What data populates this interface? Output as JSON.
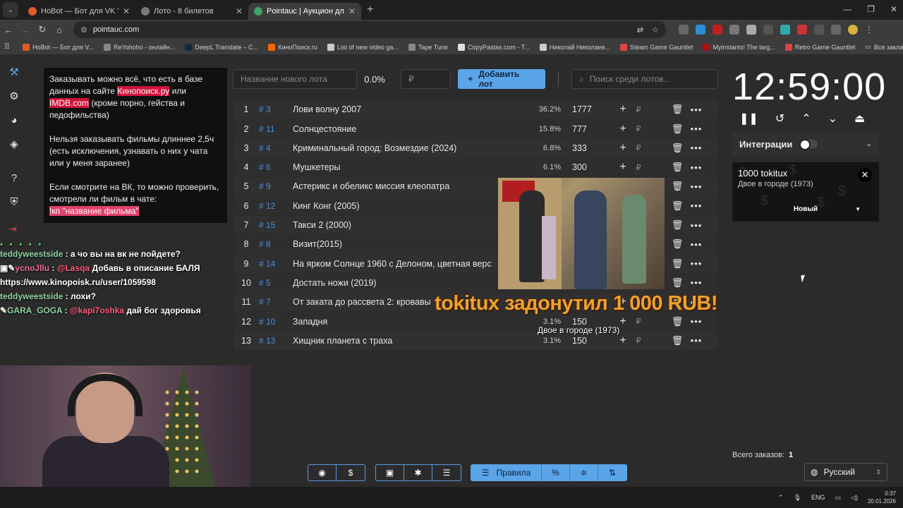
{
  "browser": {
    "tabs": [
      {
        "title": "HoBot — Бот для VK Video Live",
        "active": false,
        "color": "#e05a2a"
      },
      {
        "title": "Лото - 8 билетов",
        "active": false,
        "color": "#7a7a7a"
      },
      {
        "title": "Pointauc | Аукцион для стримов",
        "active": true,
        "color": "#3fa36a"
      }
    ],
    "url": "pointauc.com",
    "bookmarks": [
      {
        "label": "HoBot — Бот для V...",
        "color": "#e05a2a"
      },
      {
        "label": "ReYohoho - онлайн...",
        "color": "#888888"
      },
      {
        "label": "DeepL Translate – C...",
        "color": "#0f2b46"
      },
      {
        "label": "КиноПоиск.ru",
        "color": "#ff6600"
      },
      {
        "label": "List of new video ga...",
        "color": "#cccccc"
      },
      {
        "label": "Tape Tune",
        "color": "#888888"
      },
      {
        "label": "CopyPastas.com - T...",
        "color": "#e0e0e0"
      },
      {
        "label": "Николай Николаев...",
        "color": "#cccccc"
      },
      {
        "label": "Steam Game Gauntlet",
        "color": "#d44"
      },
      {
        "label": "Myinstants! The larg...",
        "color": "#aa1111"
      },
      {
        "label": "Retro Game Gauntlet",
        "color": "#d44"
      }
    ],
    "all_bookmarks": "Все закладки"
  },
  "info": {
    "p1_before": "Заказывать можно всё, что есть в базе данных на сайте ",
    "p1_link1": "Кинопоиск.ру",
    "p1_mid": " или ",
    "p1_link2": "IMDB.com",
    "p1_after": " (кроме порно, гейства и педофильства)",
    "p2": "Нельзя заказывать фильмы длиннее 2,5ч (есть исключения, узнавать о них у чата или у меня заранее)",
    "p3": "Если смотрите на ВК, то можно проверить, смотрели ли фильм в чате:",
    "p3_cmd": "!кп \"название фильма\""
  },
  "toolbar": {
    "new_lot_placeholder": "Название нового лота",
    "percent": "0.0%",
    "amount_placeholder": "₽",
    "add_button": "Добавить лот",
    "search_placeholder": "Поиск среди лотов..."
  },
  "lots": [
    {
      "n": "1",
      "id": "# 3",
      "name": "Лови волну 2007",
      "pct": "36.2%",
      "amount": "1777",
      "cur": "₽"
    },
    {
      "n": "2",
      "id": "# 11",
      "name": "Солнцестояние",
      "pct": "15.8%",
      "amount": "777",
      "cur": "₽"
    },
    {
      "n": "3",
      "id": "# 4",
      "name": "Криминальный город: Возмездие (2024)",
      "pct": "6.8%",
      "amount": "333",
      "cur": "₽"
    },
    {
      "n": "4",
      "id": "# 6",
      "name": "Мушкетеры",
      "pct": "6.1%",
      "amount": "300",
      "cur": "₽"
    },
    {
      "n": "5",
      "id": "# 9",
      "name": "Астерикс и обеликс миссия клеопатра",
      "pct": "",
      "amount": "",
      "cur": ""
    },
    {
      "n": "6",
      "id": "# 12",
      "name": "Кинг Конг (2005)",
      "pct": "",
      "amount": "",
      "cur": ""
    },
    {
      "n": "7",
      "id": "# 15",
      "name": "Такси 2 (2000)",
      "pct": "",
      "amount": "",
      "cur": ""
    },
    {
      "n": "8",
      "id": "# 8",
      "name": "Визит(2015)",
      "pct": "",
      "amount": "",
      "cur": ""
    },
    {
      "n": "9",
      "id": "# 14",
      "name": "На ярком Солнце 1960 с Делоном, цветная верс",
      "pct": "",
      "amount": "",
      "cur": ""
    },
    {
      "n": "10",
      "id": "# 5",
      "name": "Достать ножи (2019)",
      "pct": "",
      "amount": "",
      "cur": ""
    },
    {
      "n": "11",
      "id": "# 7",
      "name": "От заката до рассвета 2: кровавы",
      "pct": "",
      "amount": "",
      "cur": ""
    },
    {
      "n": "12",
      "id": "# 10",
      "name": "Западня",
      "pct": "3.1%",
      "amount": "150",
      "cur": "₽"
    },
    {
      "n": "13",
      "id": "# 13",
      "name": "Хищник планета с траха",
      "pct": "3.1%",
      "amount": "150",
      "cur": "₽"
    }
  ],
  "timer": {
    "value": "12:59:00"
  },
  "integrations": {
    "label": "Интеграции"
  },
  "donation": {
    "name": "1000 tokitux",
    "message": "Двое в городе (1973)",
    "status": "Новый"
  },
  "alert": {
    "text": "tokitux задонутил 1 000 RUB!",
    "sub": "Двое в городе (1973)"
  },
  "chat": [
    {
      "user": "teddyweestside",
      "user_color": "#8fd4a0",
      "mention": "",
      "text": "а чо вы на вк не пойдете?"
    },
    {
      "user": "ycnoJllu",
      "user_color": "#f06aa0",
      "mention": "@Lasqa",
      "text": "Добавь в описание БАЛЯ https://www.kinopoisk.ru/user/1059598"
    },
    {
      "user": "teddyweestside",
      "user_color": "#8fd4a0",
      "mention": "",
      "text": "лохи?"
    },
    {
      "user": "GARA_GOGA",
      "user_color": "#8fd4a0",
      "mention": "@kapi7oshka",
      "text": "дай бог здоровья"
    }
  ],
  "bottom": {
    "rules": "Правила",
    "orders_label": "Всего заказов:",
    "orders_count": "1",
    "language": "Русский"
  },
  "taskbar": {
    "lang": "ENG",
    "time": "0:37",
    "date": "20.01.2026"
  }
}
